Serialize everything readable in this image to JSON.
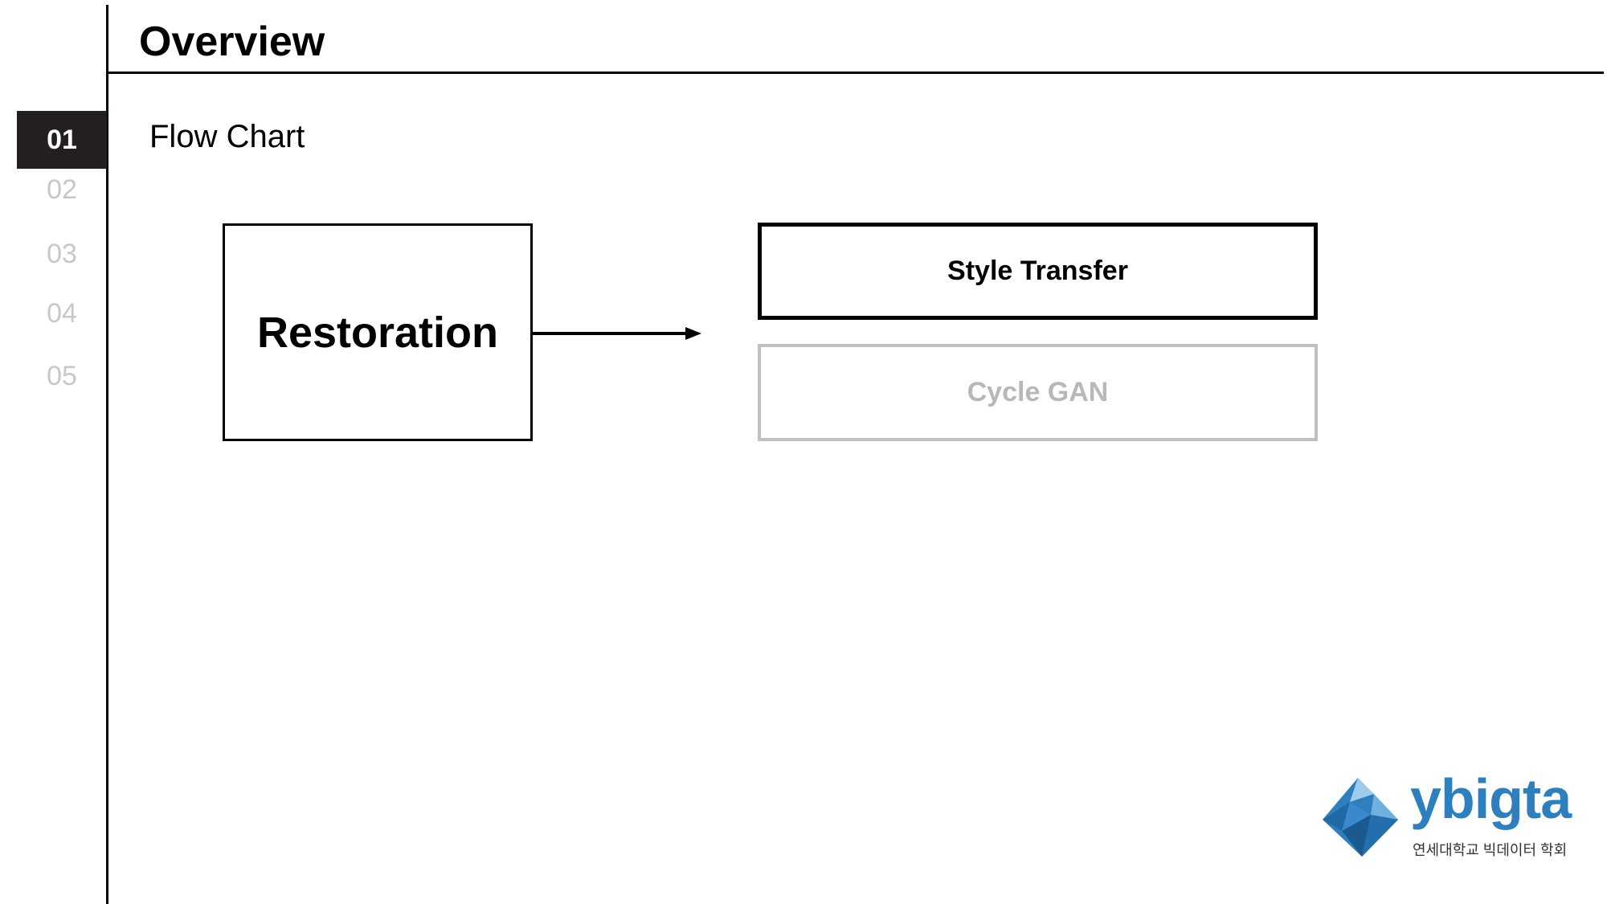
{
  "header": {
    "title": "Overview"
  },
  "nav": {
    "items": [
      {
        "label": "01",
        "active": true
      },
      {
        "label": "02",
        "active": false
      },
      {
        "label": "03",
        "active": false
      },
      {
        "label": "04",
        "active": false
      },
      {
        "label": "05",
        "active": false
      }
    ]
  },
  "section": {
    "subtitle": "Flow Chart"
  },
  "flow": {
    "source": "Restoration",
    "targets": [
      "Style Transfer",
      "Cycle GAN"
    ]
  },
  "logo": {
    "wordmark": "ybigta",
    "tagline": "연세대학교 빅데이터 학회",
    "colors": {
      "primary": "#2e7fbd",
      "light": "#9fcbea",
      "dark": "#1a5a8f"
    },
    "icon": "ice-crystal-logo-icon"
  },
  "colors": {
    "active_nav": "#231f20",
    "inactive_nav": "#c8c8c8",
    "muted_border": "#c0c0c0"
  }
}
